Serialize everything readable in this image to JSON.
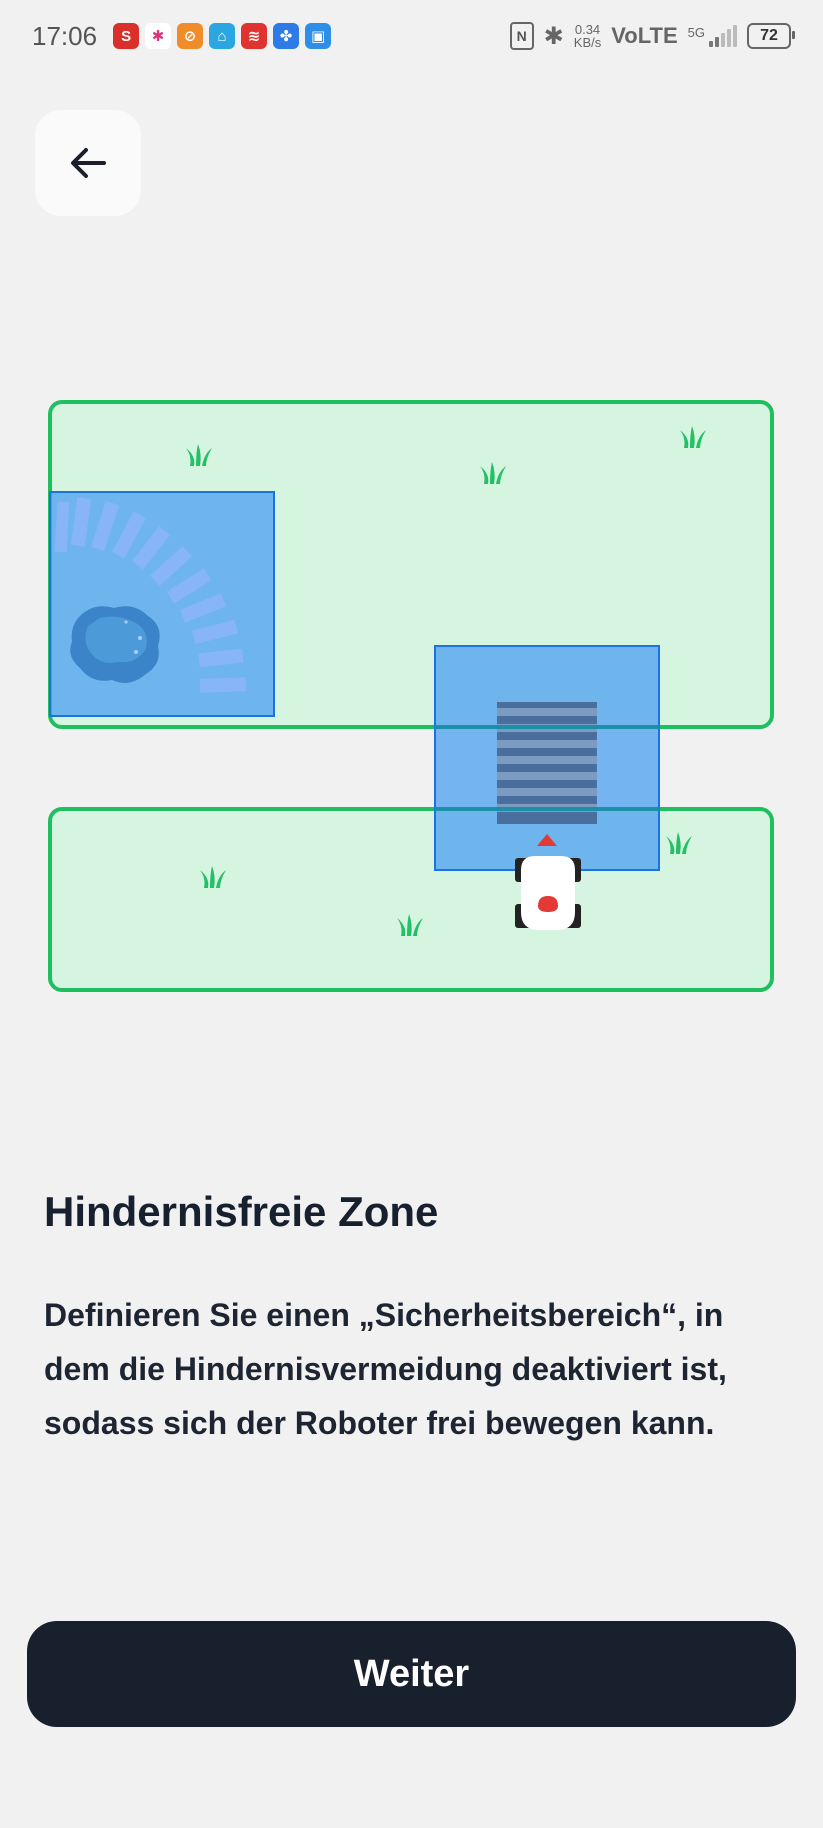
{
  "status_bar": {
    "time": "17:06",
    "network_speed_value": "0.34",
    "network_speed_unit": "KB/s",
    "volte": "VoLTE",
    "network_type": "5G",
    "battery_level": "72",
    "app_icons": [
      {
        "name": "app-s-icon",
        "glyph": "S",
        "color": "#d9302c"
      },
      {
        "name": "app-slack-icon",
        "glyph": "✱",
        "color": "#ffffff"
      },
      {
        "name": "app-orange-icon",
        "glyph": "⊘",
        "color": "#f08c2a"
      },
      {
        "name": "app-blue-leaf-icon",
        "glyph": "⌂",
        "color": "#2aa7e0"
      },
      {
        "name": "app-red-icon",
        "glyph": "≋",
        "color": "#e0332f"
      },
      {
        "name": "app-fan-icon",
        "glyph": "✤",
        "color": "#2e7ae6"
      },
      {
        "name": "app-clipboard-icon",
        "glyph": "▣",
        "color": "#2f8fe8"
      }
    ]
  },
  "header": {
    "back_icon": "arrow-left-icon"
  },
  "illustration": {
    "lawn_color": "#d6f5e0",
    "lawn_border_color": "#1fbf5f",
    "zone_color": "#4a9ff0",
    "zone_border_color": "#1a73e0",
    "icons": [
      "grass-icon",
      "pond-icon",
      "stepping-stones-icon",
      "crosswalk-icon",
      "robot-mower-icon",
      "direction-arrow-icon"
    ]
  },
  "content": {
    "title": "Hindernisfreie Zone",
    "description": "Definieren Sie einen „Sicherheitsbereich“, in dem die Hindernisvermeidung deaktiviert ist, sodass sich der Roboter frei bewegen kann."
  },
  "actions": {
    "continue_label": "Weiter"
  }
}
